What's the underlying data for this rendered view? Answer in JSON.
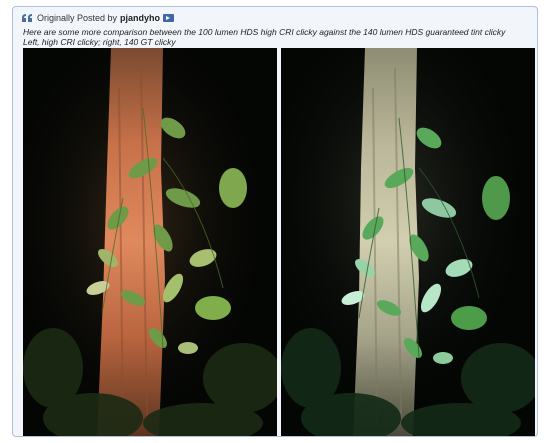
{
  "quote": {
    "prefix": "Originally Posted by",
    "author": "pjandyho",
    "line1": "Here are some more comparison between the 100 lumen HDS high CRI clicky against the 140 lumen HDS guaranteed tint clicky",
    "line2": "Left, high CRI clicky; right, 140 GT clicky"
  },
  "icons": {
    "quote": "quote-icon",
    "view_post": "view-post-icon"
  },
  "photos": {
    "left": {
      "subject": "tree trunk lit by high CRI flashlight at night",
      "tint": "warm"
    },
    "right": {
      "subject": "tree trunk lit by 140 lumen GT flashlight at night",
      "tint": "cool"
    }
  },
  "colors": {
    "quote_border": "#aebfd8",
    "quote_background": "#f2f6fb",
    "icon_blue": "#3d69a8",
    "warm_trunk": "#d9825a",
    "cool_trunk": "#c9c8a8",
    "warm_leaf": "#8eae5a",
    "cool_leaf": "#7ec27a"
  }
}
